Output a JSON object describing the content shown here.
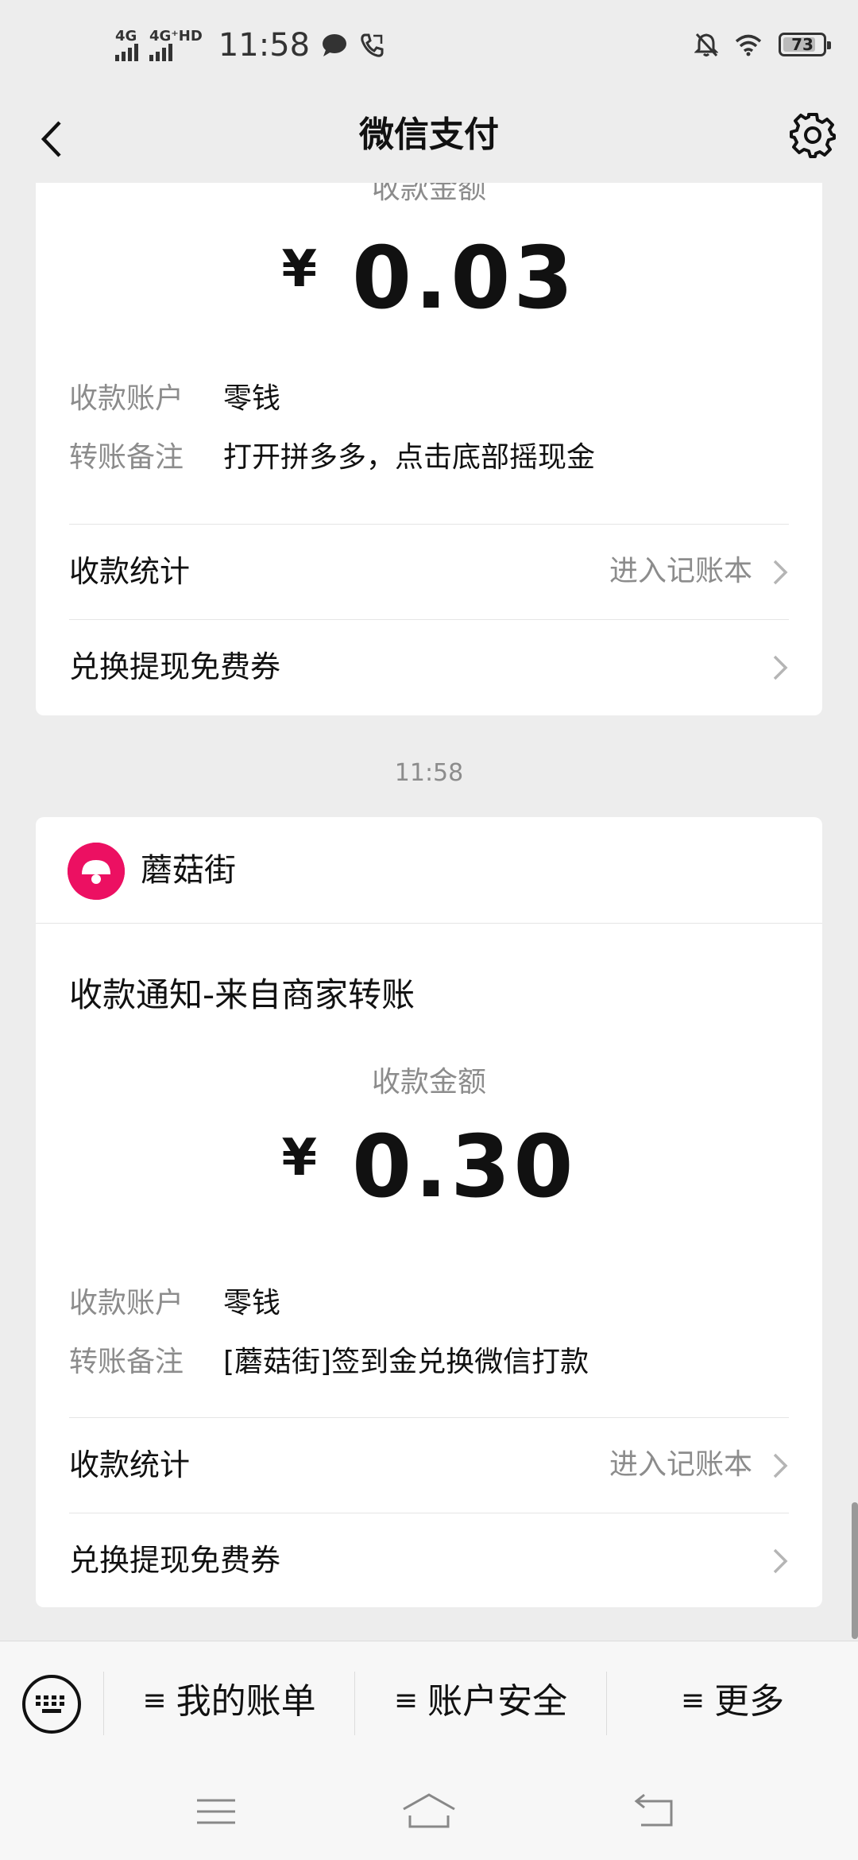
{
  "status_bar": {
    "network_1": "4G",
    "network_2": "4G⁺HD",
    "time": "11:58",
    "battery": "73",
    "icons": [
      "chat-bubble-icon",
      "phone-call-icon",
      "mute-bell-icon",
      "wifi-icon",
      "battery-icon"
    ]
  },
  "nav": {
    "title": "微信支付",
    "back_icon": "chevron-left-icon",
    "settings_icon": "gear-icon"
  },
  "messages": [
    {
      "amount_label": "收款金额",
      "currency": "¥",
      "amount": "0.03",
      "account_key": "收款账户",
      "account_value": "零钱",
      "remark_key": "转账备注",
      "remark_value": "打开拼多多，点击底部摇现金",
      "stats_label": "收款统计",
      "stats_link": "进入记账本",
      "voucher_label": "兑换提现免费券"
    },
    {
      "timestamp": "11:58",
      "merchant": "蘑菇街",
      "notice_title": "收款通知-来自商家转账",
      "amount_label": "收款金额",
      "currency": "¥",
      "amount": "0.30",
      "account_key": "收款账户",
      "account_value": "零钱",
      "remark_key": "转账备注",
      "remark_value": "[蘑菇街]签到金兑换微信打款",
      "stats_label": "收款统计",
      "stats_link": "进入记账本",
      "voucher_label": "兑换提现免费券"
    }
  ],
  "bottom_menu": {
    "menu_icon": "≡",
    "items": [
      "我的账单",
      "账户安全",
      "更多"
    ]
  },
  "colors": {
    "background": "#ededed",
    "card": "#ffffff",
    "secondary_text": "#8c8c8c",
    "merchant_brand": "#ec1062"
  }
}
